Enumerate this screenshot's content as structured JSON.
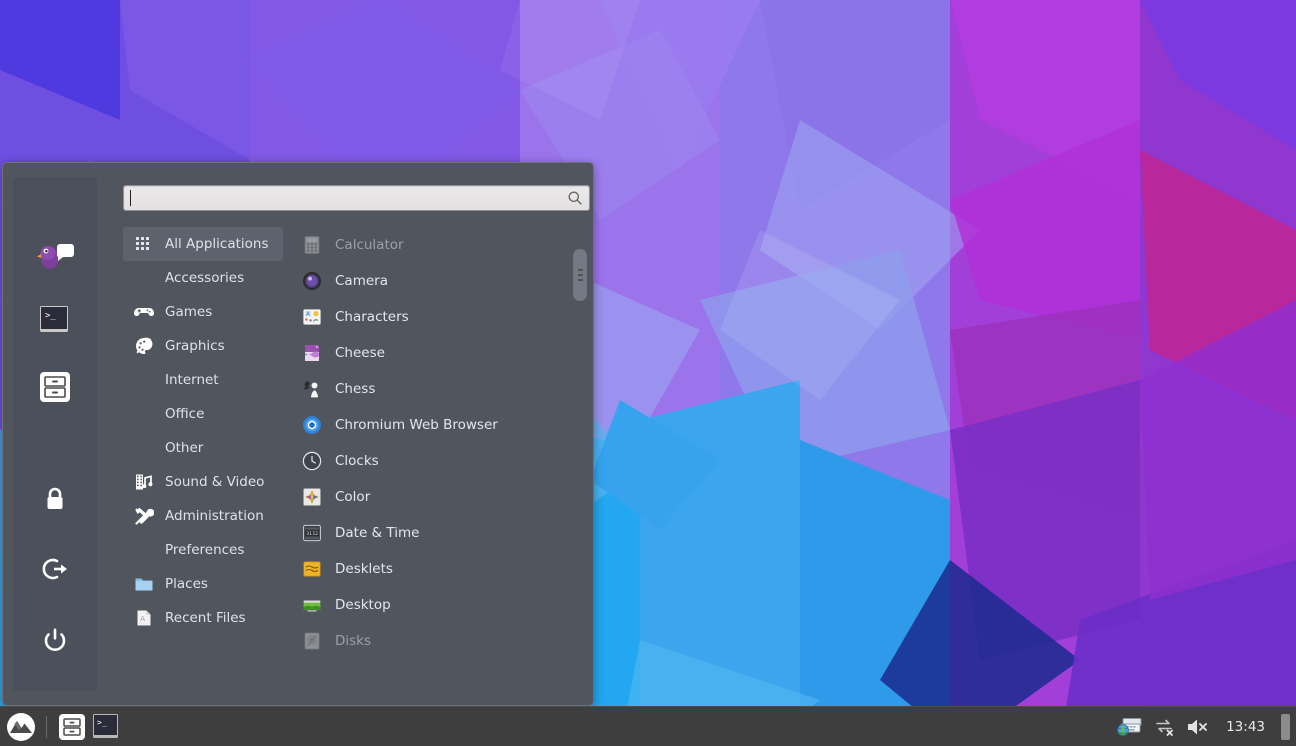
{
  "desktop": {
    "wallpaper_name": "geometric-polygon-wallpaper",
    "colors": {
      "accent_purple": "#8b5cf6",
      "accent_blue": "#2196f3",
      "accent_magenta": "#c2238e",
      "panel_bg": "#50555e",
      "taskbar_bg": "#3e3e3e"
    }
  },
  "menu": {
    "search": {
      "value": "",
      "placeholder": "",
      "icon": "search-icon"
    },
    "favorites": [
      {
        "name": "pidgin-internet-messenger",
        "icon": "pidgin-icon"
      },
      {
        "name": "terminal",
        "icon": "terminal-icon"
      },
      {
        "name": "files",
        "icon": "files-icon"
      }
    ],
    "session_buttons": [
      {
        "name": "lock-screen",
        "icon": "lock-icon"
      },
      {
        "name": "log-out",
        "icon": "logout-icon"
      },
      {
        "name": "quit",
        "icon": "power-icon"
      }
    ],
    "categories": [
      {
        "label": "All Applications",
        "icon": "grid-icon",
        "selected": true
      },
      {
        "label": "Accessories",
        "icon": "none",
        "selected": false
      },
      {
        "label": "Games",
        "icon": "gamepad-icon",
        "selected": false
      },
      {
        "label": "Graphics",
        "icon": "palette-icon",
        "selected": false
      },
      {
        "label": "Internet",
        "icon": "none",
        "selected": false
      },
      {
        "label": "Office",
        "icon": "none",
        "selected": false
      },
      {
        "label": "Other",
        "icon": "none",
        "selected": false
      },
      {
        "label": "Sound & Video",
        "icon": "film-music-icon",
        "selected": false
      },
      {
        "label": "Administration",
        "icon": "tools-icon",
        "selected": false
      },
      {
        "label": "Preferences",
        "icon": "none",
        "selected": false
      },
      {
        "label": "Places",
        "icon": "folder-icon",
        "selected": false
      },
      {
        "label": "Recent Files",
        "icon": "recent-file-icon",
        "selected": false
      }
    ],
    "applications": [
      {
        "label": "Calculator",
        "icon": "calculator-icon",
        "faded": true
      },
      {
        "label": "Camera",
        "icon": "camera-icon",
        "faded": false
      },
      {
        "label": "Characters",
        "icon": "characters-icon",
        "faded": false
      },
      {
        "label": "Cheese",
        "icon": "cheese-icon",
        "faded": false
      },
      {
        "label": "Chess",
        "icon": "chess-icon",
        "faded": false
      },
      {
        "label": "Chromium Web Browser",
        "icon": "chromium-icon",
        "faded": false
      },
      {
        "label": "Clocks",
        "icon": "clocks-icon",
        "faded": false
      },
      {
        "label": "Color",
        "icon": "color-icon",
        "faded": false
      },
      {
        "label": "Date & Time",
        "icon": "datetime-icon",
        "faded": false
      },
      {
        "label": "Desklets",
        "icon": "desklets-icon",
        "faded": false
      },
      {
        "label": "Desktop",
        "icon": "desktop-icon",
        "faded": false
      },
      {
        "label": "Disks",
        "icon": "disks-icon",
        "faded": true
      }
    ]
  },
  "taskbar": {
    "menu_button": {
      "name": "mint-menu-button",
      "icon": "mint-logo-icon"
    },
    "launchers": [
      {
        "name": "files-launcher",
        "icon": "files-icon"
      },
      {
        "name": "terminal-launcher",
        "icon": "terminal-icon"
      }
    ],
    "tray": [
      {
        "name": "input-method",
        "icon": "keyboard-globe-icon"
      },
      {
        "name": "network-disconnected",
        "icon": "network-offline-icon"
      },
      {
        "name": "volume-muted",
        "icon": "volume-muted-icon"
      }
    ],
    "clock": "13:43"
  }
}
